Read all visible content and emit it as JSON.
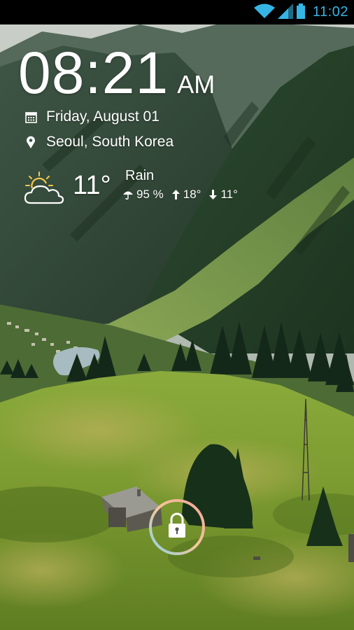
{
  "status_bar": {
    "time": "11:02",
    "accent_color": "#35b5e5",
    "icons": [
      "wifi-icon",
      "cell-signal-icon",
      "battery-icon"
    ]
  },
  "lockscreen": {
    "clock": {
      "time": "08:21",
      "ampm": "AM"
    },
    "date": "Friday, August 01",
    "location": "Seoul, South Korea",
    "weather": {
      "icon": "partly-cloudy-icon",
      "temperature": "11°",
      "condition": "Rain",
      "precipitation": "95 %",
      "high": "18°",
      "low": "11°"
    },
    "unlock": {
      "icon": "padlock-icon"
    }
  }
}
